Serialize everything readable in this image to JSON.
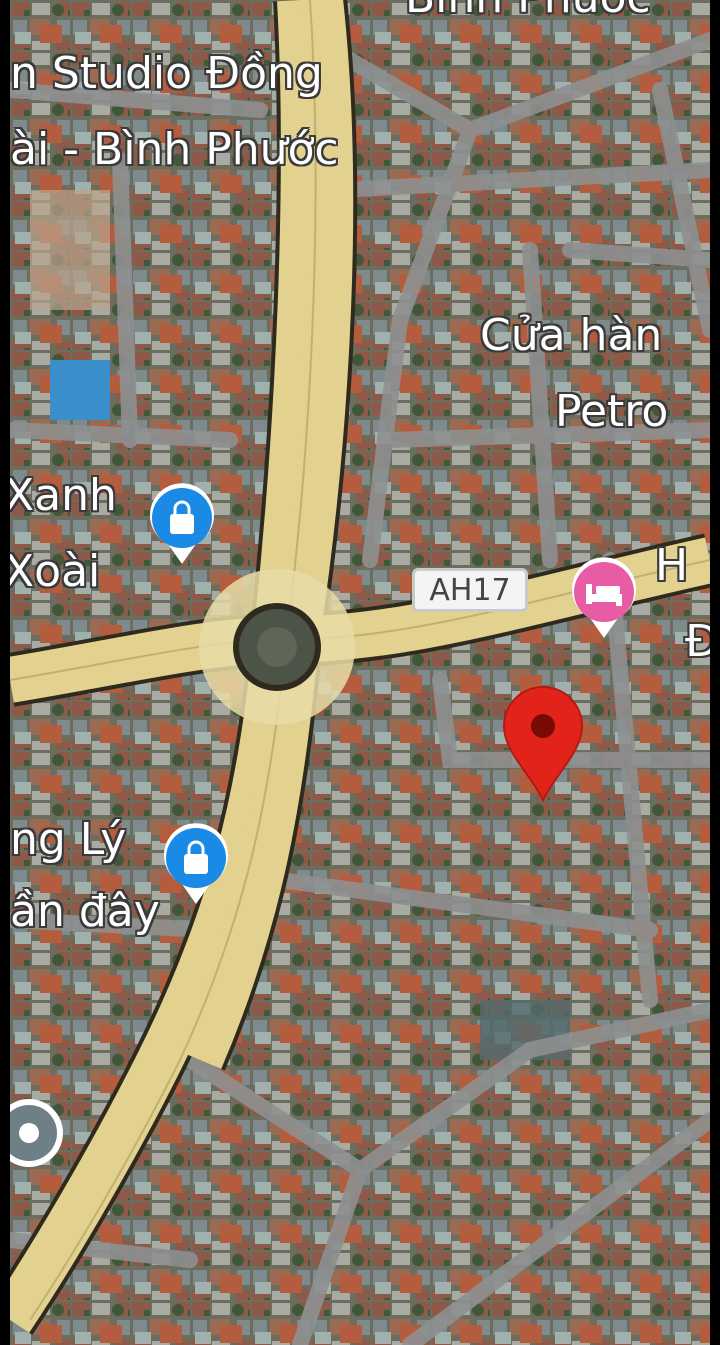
{
  "map": {
    "labels": {
      "studio_line1": "n Studio Đồng",
      "studio_line2": "ài - Bình Phước",
      "top_cut": "Bình Phước",
      "cua_hang_line1": "Cửa hàn",
      "cua_hang_line2": "Petro",
      "xanh_line1": "Xanh",
      "xanh_line2": "Xoài",
      "ng_ly_line1": "ng Lý",
      "ng_ly_line2": "ần đây",
      "right_h_line1": "H",
      "right_h_line2": "Đ"
    },
    "road_shield": "AH17",
    "icons": {
      "shopping_left_top": "shopping-bag-icon",
      "shopping_left_bottom": "shopping-bag-icon",
      "hotel": "bed-icon",
      "destination": "map-pin-icon",
      "poi_left": "place-icon"
    },
    "colors": {
      "highway": "#e3d18f",
      "highway_outline": "#2e2a1e",
      "street": "#8e9090",
      "shopping_pin": "#1a8ae6",
      "hotel_pin": "#e85ca6",
      "destination_pin": "#e2231a"
    }
  }
}
